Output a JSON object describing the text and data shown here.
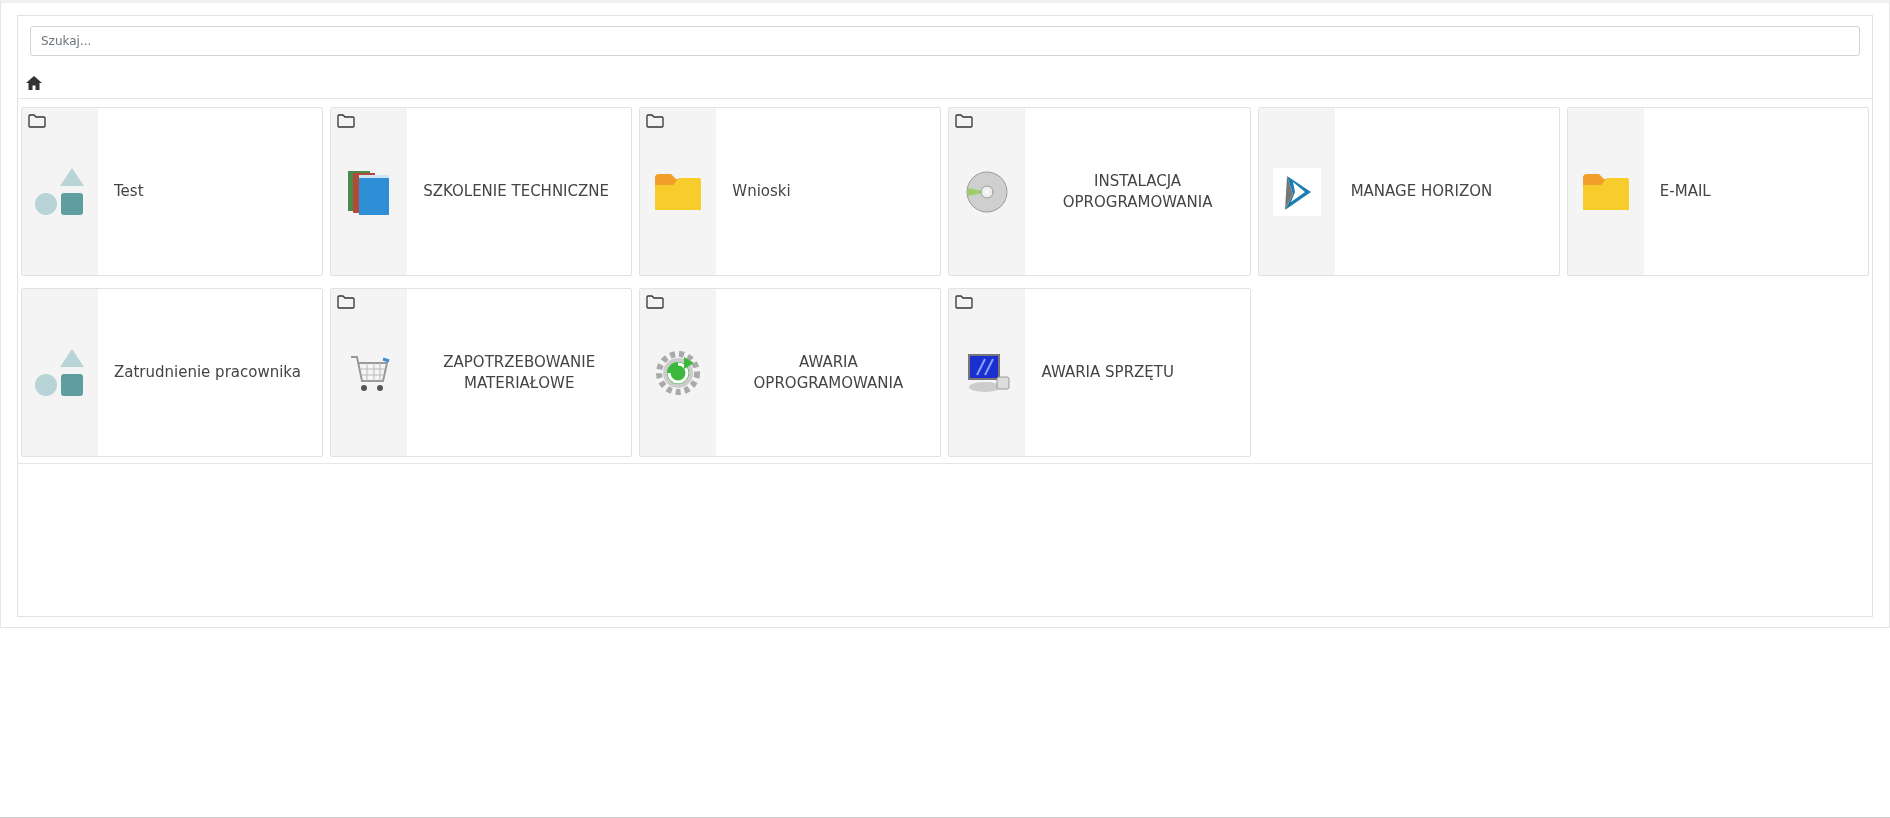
{
  "search": {
    "placeholder": "Szukaj..."
  },
  "tiles": [
    {
      "label": "Test",
      "kind": "folder"
    },
    {
      "label": "SZKOLENIE TECHNICZNE",
      "kind": "folder"
    },
    {
      "label": "Wnioski",
      "kind": "folder"
    },
    {
      "label": "INSTALACJA OPROGRAMOWANIA",
      "kind": "folder"
    },
    {
      "label": "MANAGE HORIZON",
      "kind": "item"
    },
    {
      "label": "E-MAIL",
      "kind": "item"
    },
    {
      "label": "Zatrudnienie pracownika",
      "kind": "item"
    },
    {
      "label": "ZAPOTRZEBOWANIE MATERIAŁOWE",
      "kind": "folder"
    },
    {
      "label": "AWARIA OPROGRAMOWANIA",
      "kind": "folder"
    },
    {
      "label": "AWARIA SPRZĘTU",
      "kind": "folder"
    }
  ]
}
